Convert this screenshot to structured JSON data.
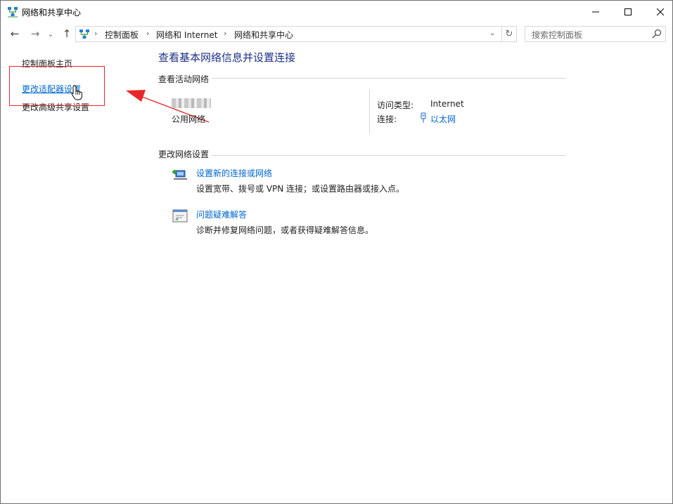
{
  "window": {
    "title": "网络和共享中心",
    "controls": {
      "minimize": "—",
      "maximize": "☐",
      "close": "✕"
    }
  },
  "nav": {
    "back": "←",
    "forward": "→",
    "recent": "⌄",
    "up": "↑",
    "breadcrumbs": [
      "控制面板",
      "网络和 Internet",
      "网络和共享中心"
    ],
    "separator": "›",
    "dropdown": "⌄",
    "refresh": "↻",
    "search_placeholder": "搜索控制面板"
  },
  "left_pane": {
    "links": [
      "控制面板主页",
      "更改适配器设置",
      "更改高级共享设置"
    ]
  },
  "main": {
    "heading": "查看基本网络信息并设置连接",
    "active_networks": {
      "label": "查看活动网络",
      "network_type": "公用网络",
      "access_type_label": "访问类型:",
      "access_type_value": "Internet",
      "connections_label": "连接:",
      "connections_value": "以太网"
    },
    "change_settings": {
      "label": "更改网络设置",
      "tasks": [
        {
          "link": "设置新的连接或网络",
          "desc": "设置宽带、拨号或 VPN 连接；或设置路由器或接入点。"
        },
        {
          "link": "问题疑难解答",
          "desc": "诊断并修复网络问题，或者获得疑难解答信息。"
        }
      ]
    }
  },
  "colors": {
    "link": "#0066cc",
    "heading": "#1e3287",
    "annotation": "#e8272a"
  }
}
